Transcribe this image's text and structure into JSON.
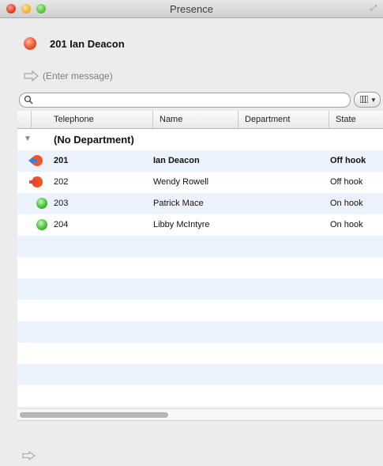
{
  "window": {
    "title": "Presence"
  },
  "user": {
    "name": "201 Ian Deacon",
    "status_color": "#f0552a"
  },
  "message": {
    "placeholder": "(Enter message)"
  },
  "search": {
    "value": ""
  },
  "table": {
    "columns": [
      "Telephone",
      "Name",
      "Department",
      "State"
    ],
    "group": "(No Department)",
    "rows": [
      {
        "ext": "201",
        "name": "Ian Deacon",
        "state": "Off hook",
        "icon": "call-outgoing-icon",
        "bold": true
      },
      {
        "ext": "202",
        "name": "Wendy Rowell",
        "state": "Off hook",
        "icon": "call-incoming-icon",
        "bold": false
      },
      {
        "ext": "203",
        "name": "Patrick Mace",
        "state": "On hook",
        "icon": "available-icon",
        "bold": false
      },
      {
        "ext": "204",
        "name": "Libby McIntyre",
        "state": "On hook",
        "icon": "available-icon",
        "bold": false
      }
    ]
  },
  "colors": {
    "busy": "#f0552a",
    "available": "#45c23a",
    "alt_row": "#edf3fe",
    "arrow_blue": "#3a7fd6"
  }
}
